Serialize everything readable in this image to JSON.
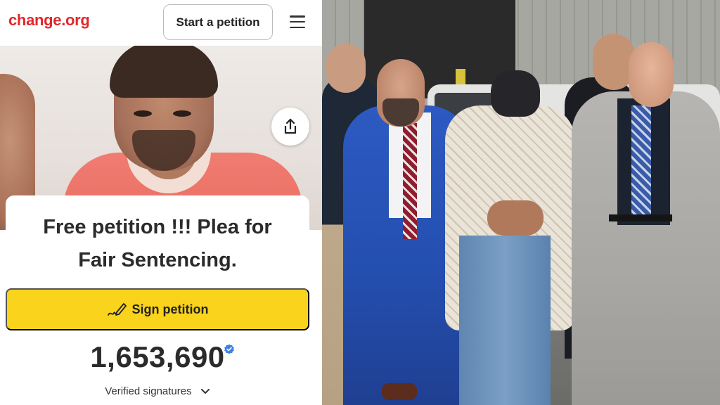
{
  "topbar": {
    "logo_text": "change.org",
    "start_button_label": "Start a petition",
    "menu_icon": "hamburger-menu-icon"
  },
  "petition": {
    "share_icon": "share-icon",
    "title_line1": "Free petition !!! Plea for",
    "title_line2": "Fair Sentencing.",
    "sign_button_label": "Sign petition",
    "sign_icon": "pen-signature-icon",
    "signature_count": "1,653,690",
    "verified_badge_icon": "verified-check-icon",
    "verified_label": "Verified signatures",
    "verified_toggle_icon": "chevron-down-icon"
  },
  "colors": {
    "brand_red": "#e0282c",
    "sign_button_yellow": "#f9d31c",
    "verified_blue": "#3b82e6"
  }
}
